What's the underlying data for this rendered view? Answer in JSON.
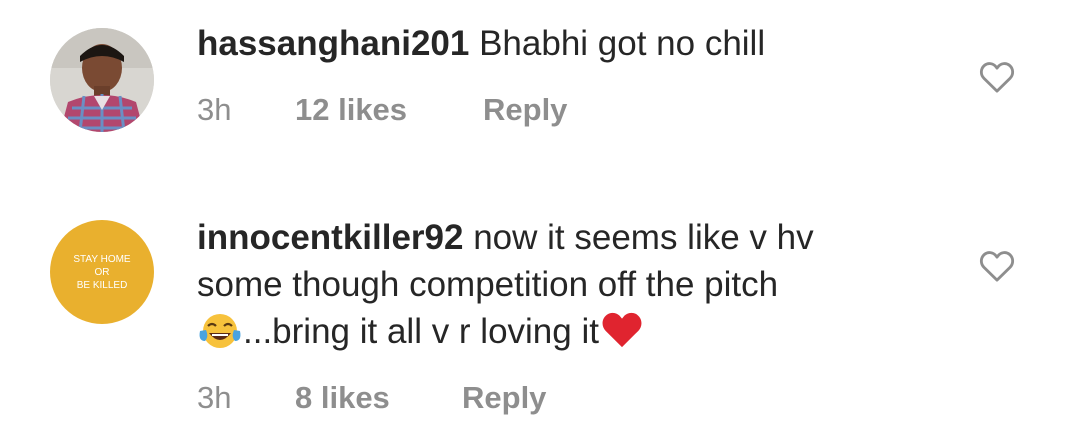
{
  "comments": [
    {
      "username": "hassanghani201",
      "text": "Bhabhi got no chill",
      "time": "3h",
      "likes": "12 likes",
      "reply": "Reply"
    },
    {
      "username": "innocentkiller92",
      "text_line1": "now it seems like v hv",
      "text_line2": "some though competition off the pitch",
      "text_line3": "...bring it all v r loving it",
      "avatar_text": [
        "STAY HOME",
        "OR",
        "BE KILLED"
      ],
      "time": "3h",
      "likes": "8 likes",
      "reply": "Reply"
    }
  ],
  "colors": {
    "text": "#262626",
    "meta": "#8e8e8e",
    "avatar2_bg": "#e9b02e",
    "heart_red": "#e0242f"
  },
  "icons": {
    "like": "heart-outline-icon",
    "emoji": "face-with-tears-of-joy-emoji",
    "heart": "red-heart-emoji"
  }
}
